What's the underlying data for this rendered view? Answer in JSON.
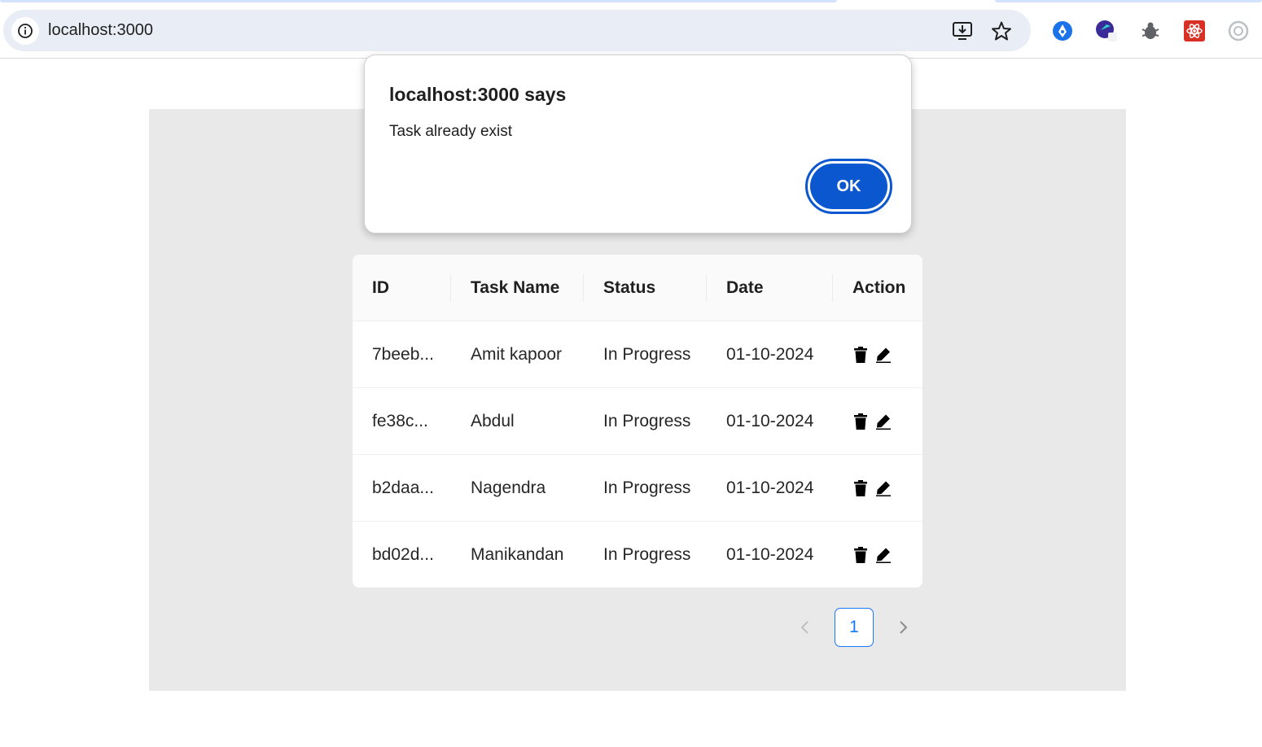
{
  "browser": {
    "url": "localhost:3000"
  },
  "dialog": {
    "title": "localhost:3000 says",
    "message": "Task already exist",
    "ok_label": "OK"
  },
  "table": {
    "columns": [
      "ID",
      "Task Name",
      "Status",
      "Date",
      "Action"
    ],
    "rows": [
      {
        "id": "7beeb...",
        "name": "Amit kapoor",
        "status": "In Progress",
        "date": "01-10-2024"
      },
      {
        "id": "fe38c...",
        "name": "Abdul",
        "status": "In Progress",
        "date": "01-10-2024"
      },
      {
        "id": "b2daa...",
        "name": "Nagendra",
        "status": "In Progress",
        "date": "01-10-2024"
      },
      {
        "id": "bd02d...",
        "name": "Manikandan",
        "status": "In Progress",
        "date": "01-10-2024"
      }
    ],
    "action_icons": [
      "trash-icon",
      "edit-icon"
    ]
  },
  "pagination": {
    "current_page": "1"
  },
  "colors": {
    "accent": "#1677ff",
    "dialog_button": "#0b57d0",
    "panel_bg": "#e9e9e9"
  }
}
